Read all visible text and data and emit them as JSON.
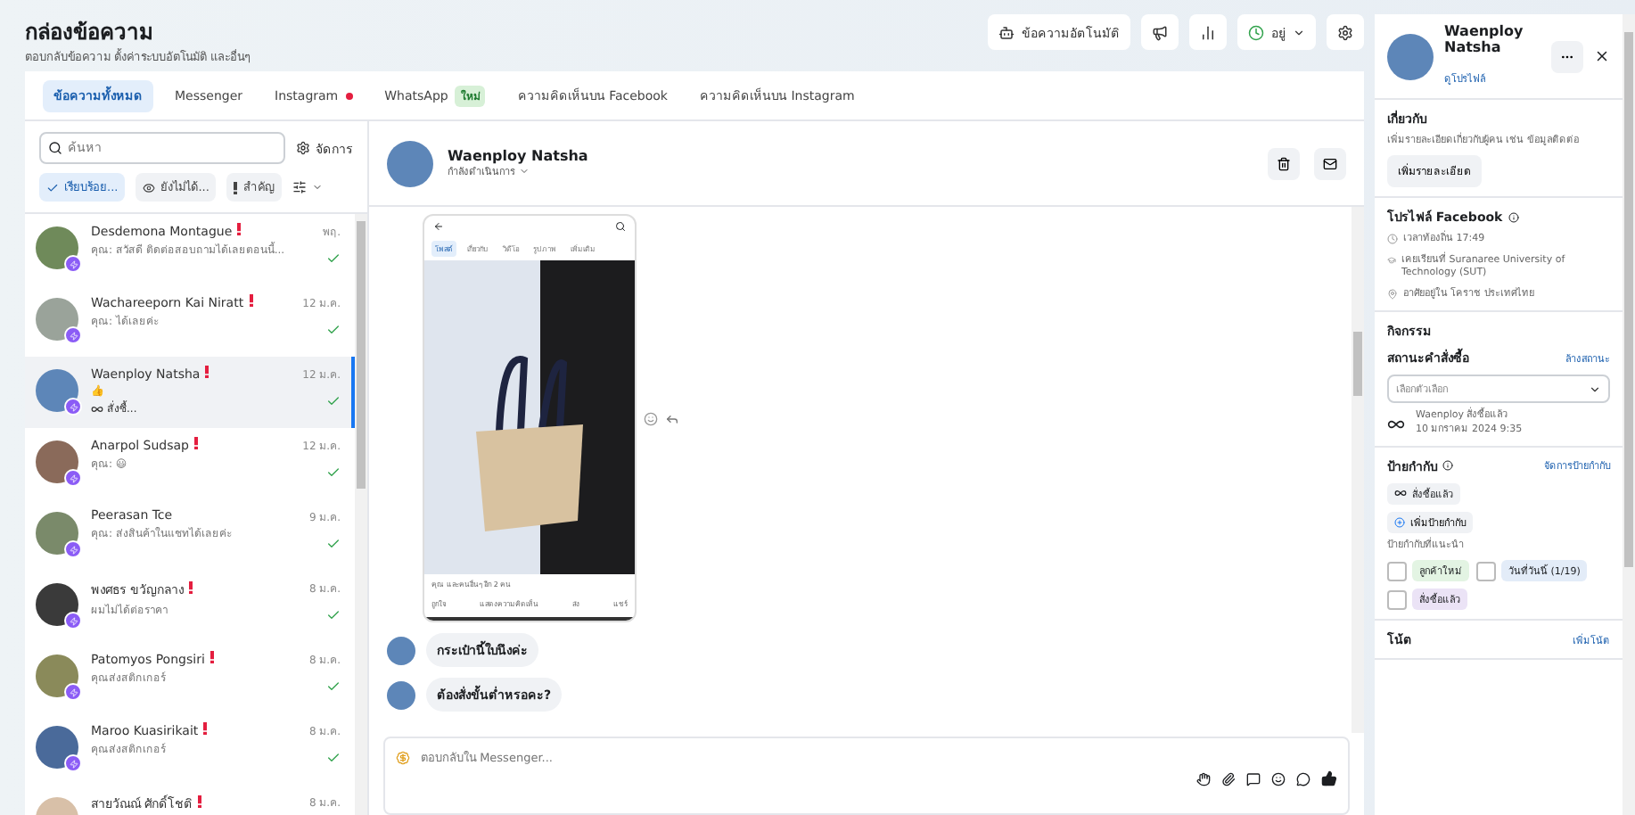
{
  "header": {
    "title": "กล่องข้อความ",
    "subtitle": "ตอบกลับข้อความ ตั้งค่าระบบอัตโนมัติ และอื่นๆ",
    "auto_reply": "ข้อความอัตโนมัติ",
    "status": "อยู่"
  },
  "tabs": [
    {
      "label": "ข้อความทั้งหมด",
      "selected": true
    },
    {
      "label": "Messenger",
      "selected": false
    },
    {
      "label": "Instagram",
      "selected": false,
      "alert": true
    },
    {
      "label": "WhatsApp",
      "selected": false,
      "badge": "ใหม่"
    },
    {
      "label": "ความคิดเห็นบน Facebook",
      "selected": false
    },
    {
      "label": "ความคิดเห็นบน Instagram",
      "selected": false
    }
  ],
  "inbox": {
    "search": {
      "placeholder": "ค้นหา"
    },
    "manage": "จัดการ",
    "filters": [
      {
        "kind": "check",
        "label": "เรียบร้อย...",
        "selected": true
      },
      {
        "kind": "eye",
        "label": "ยังไม่ได้...",
        "selected": false
      },
      {
        "kind": "bang",
        "label": "สำคัญ",
        "selected": false
      }
    ],
    "conversations": [
      {
        "name": "Desdemona Montague",
        "important": true,
        "preview": "คุณ: สวัสดี ติดต่อสอบถามได้เลยตอนนี้...",
        "time": "พฤ.",
        "selected": false
      },
      {
        "name": "Wachareeporn Kai Niratt",
        "important": true,
        "preview": "คุณ: ได้เลยค่ะ",
        "time": "12 ม.ค.",
        "selected": false
      },
      {
        "name": "Waenploy Natsha",
        "important": true,
        "preview": "👍",
        "tag": "สั่งซื้...",
        "time": "12 ม.ค.",
        "selected": true
      },
      {
        "name": "Anarpol Sudsap",
        "important": true,
        "preview": "คุณ: 😃",
        "time": "12 ม.ค.",
        "selected": false
      },
      {
        "name": "Peerasan Tce",
        "important": false,
        "preview": "คุณ: ส่งสินค้าในแชทได้เลยค่ะ",
        "time": "9 ม.ค.",
        "selected": false
      },
      {
        "name": "พงศธร ขวัญกลาง",
        "important": true,
        "preview": "ผมไม่ได้ต่อราคา",
        "time": "8 ม.ค.",
        "selected": false
      },
      {
        "name": "Patomyos Pongsiri",
        "important": true,
        "preview": "คุณส่งสติกเกอร์",
        "time": "8 ม.ค.",
        "selected": false
      },
      {
        "name": "Maroo Kuasirikait",
        "important": true,
        "preview": "คุณส่งสติกเกอร์",
        "time": "8 ม.ค.",
        "selected": false
      },
      {
        "name": "สายวัณณ์ ศักดิ์โชติ",
        "important": true,
        "time": "8 ม.ค.",
        "selected": false
      }
    ]
  },
  "chat": {
    "name": "Waenploy Natsha",
    "status": "กำลังดำเนินการ",
    "shared_screenshot": {
      "tabs": [
        {
          "label": "โพสต์",
          "selected": true
        },
        {
          "label": "เกี่ยวกับ",
          "selected": false
        },
        {
          "label": "วิดีโอ",
          "selected": false
        },
        {
          "label": "รูปภาพ",
          "selected": false
        },
        {
          "label": "เพิ่มเติม",
          "selected": false
        }
      ],
      "reactions": "คุณ และคนอื่นๆ อีก 2 คน",
      "actions": [
        "ถูกใจ",
        "แสดงความคิดเห็น",
        "ส่ง",
        "แชร์"
      ]
    },
    "messages": [
      "กระเป๋านี้ใบนึงค่ะ",
      "ต้องสั่งขั้นต่ำหรอคะ?"
    ],
    "composer": {
      "placeholder": "ตอบกลับใน Messenger..."
    }
  },
  "contact": {
    "name": "Waenploy Natsha",
    "profile_link": "ดูโปรไฟล์",
    "about": {
      "title": "เกี่ยวกับ",
      "text": "เพิ่มรายละเอียดเกี่ยวกับผู้คน เช่น ข้อมูลติดต่อ",
      "button": "เพิ่มรายละเอียด"
    },
    "facebook_profile": {
      "title": "โปรไฟล์ Facebook",
      "items": [
        {
          "kind": "clock",
          "text": "เวลาท้องถิ่น 17:49"
        },
        {
          "kind": "school",
          "text": "เคยเรียนที่ Suranaree University of Technology (SUT)"
        },
        {
          "kind": "place",
          "text": "อาศัยอยู่ใน โคราช ประเทศไทย"
        }
      ]
    },
    "activity": {
      "title": "กิจกรรม",
      "order_status": "สถานะคำสั่งซื้อ",
      "clear": "ล้างสถานะ",
      "select_placeholder": "เลือกตัวเลือก",
      "event": "Waenploy สั่งซื้อแล้ว",
      "event_time": "10 มกราคม 2024 9:35"
    },
    "labels": {
      "title": "ป้ายกำกับ",
      "manage": "จัดการป้ายกำกับ",
      "applied": [
        "สั่งซื้อแล้ว"
      ],
      "add": "เพิ่มป้ายกำกับ",
      "suggested_title": "ป้ายกำกับที่แนะนำ",
      "suggested": [
        {
          "label": "ลูกค้าใหม่",
          "checked": false,
          "color": "#e3f4e3"
        },
        {
          "label": "วันที่วันนี้ (1/19)",
          "checked": false,
          "color": "#e3ecf8"
        },
        {
          "label": "สั่งซื้อแล้ว",
          "checked": false,
          "color": "#ebe3f6"
        }
      ]
    },
    "notes": {
      "title": "โน้ต",
      "add": "เพิ่มโน้ต"
    }
  }
}
